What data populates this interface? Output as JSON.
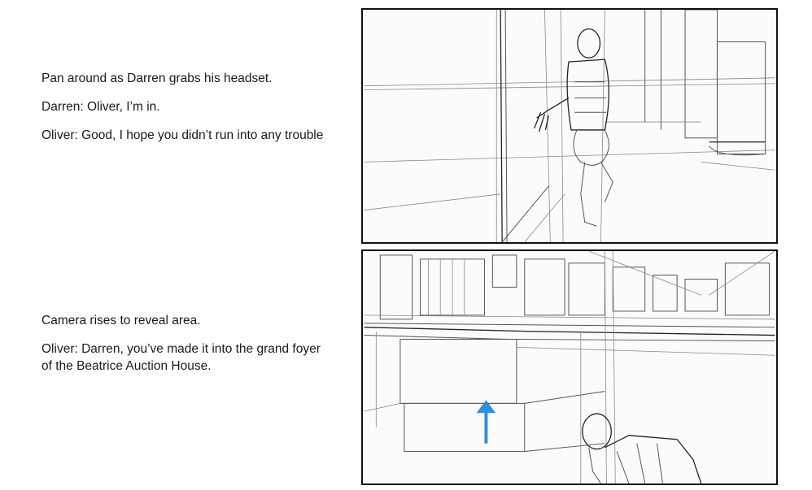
{
  "shots": [
    {
      "direction": "Pan around as Darren grabs his headset.",
      "lines": [
        "Darren: Oliver, I’m in.",
        "Oliver:  Good, I hope you didn’t run into any trouble"
      ]
    },
    {
      "direction": "Camera rises to reveal area.",
      "lines": [
        "Oliver:  Darren, you’ve made it into the grand foyer of the Beatrice Auction House."
      ]
    }
  ],
  "colors": {
    "arrow": "#2b8fe0",
    "frame": "#111111"
  }
}
